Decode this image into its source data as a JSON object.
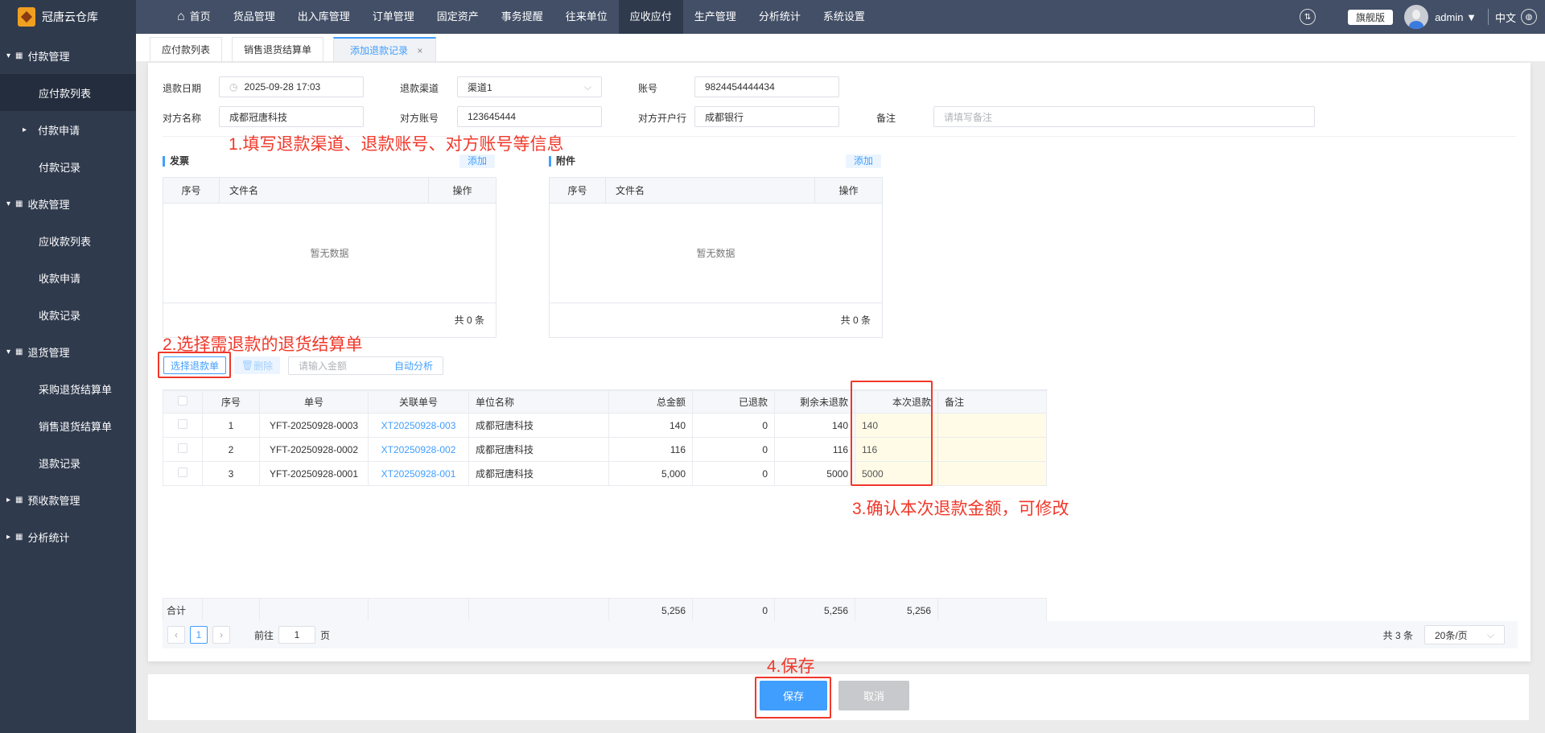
{
  "app": {
    "title": "冠唐云仓库"
  },
  "topnav": {
    "items": [
      "首页",
      "货品管理",
      "出入库管理",
      "订单管理",
      "固定资产",
      "事务提醒",
      "往来单位",
      "应收应付",
      "生产管理",
      "分析统计",
      "系统设置"
    ],
    "active": "应收应付",
    "edition": "旗舰版",
    "user": "admin",
    "language": "中文"
  },
  "sidebar": {
    "items": [
      {
        "label": "付款管理",
        "type": "group"
      },
      {
        "label": "应付款列表",
        "type": "sub",
        "active": true
      },
      {
        "label": "付款申请",
        "type": "sub-arrow"
      },
      {
        "label": "付款记录",
        "type": "sub"
      },
      {
        "label": "收款管理",
        "type": "group"
      },
      {
        "label": "应收款列表",
        "type": "sub"
      },
      {
        "label": "收款申请",
        "type": "sub"
      },
      {
        "label": "收款记录",
        "type": "sub"
      },
      {
        "label": "退货管理",
        "type": "group"
      },
      {
        "label": "采购退货结算单",
        "type": "sub"
      },
      {
        "label": "销售退货结算单",
        "type": "sub"
      },
      {
        "label": "退款记录",
        "type": "sub"
      },
      {
        "label": "预收款管理",
        "type": "group-collapsed"
      },
      {
        "label": "分析统计",
        "type": "group-collapsed"
      }
    ]
  },
  "tabs": [
    {
      "label": "应付款列表"
    },
    {
      "label": "销售退货结算单"
    },
    {
      "label": "添加退款记录",
      "active": true,
      "close": "×"
    }
  ],
  "form": {
    "refund_date_label": "退款日期",
    "refund_date": "2025-09-28 17:03",
    "channel_label": "退款渠道",
    "channel": "渠道1",
    "account_label": "账号",
    "account": "9824454444434",
    "party_name_label": "对方名称",
    "party_name": "成都冠唐科技",
    "party_account_label": "对方账号",
    "party_account": "123645444",
    "party_bank_label": "对方开户行",
    "party_bank": "成都银行",
    "remark_label": "备注",
    "remark_placeholder": "请填写备注"
  },
  "annotations": {
    "a1": "1.填写退款渠道、退款账号、对方账号等信息",
    "a2": "2.选择需退款的退货结算单",
    "a3": "3.确认本次退款金额，可修改",
    "a4": "4.保存"
  },
  "invoice": {
    "title": "发票",
    "add": "添加",
    "cols": [
      "序号",
      "文件名",
      "操作"
    ],
    "empty": "暂无数据",
    "footer": "共 0 条"
  },
  "attachment": {
    "title": "附件",
    "add": "添加",
    "cols": [
      "序号",
      "文件名",
      "操作"
    ],
    "empty": "暂无数据",
    "footer": "共 0 条"
  },
  "toolbar": {
    "select": "选择退款单",
    "delete": "删除",
    "amount_placeholder": "请输入金额",
    "auto": "自动分析"
  },
  "table": {
    "headers": [
      "序号",
      "单号",
      "关联单号",
      "单位名称",
      "总金额",
      "已退款",
      "剩余未退款",
      "本次退款",
      "备注"
    ],
    "rows": [
      {
        "no": "1",
        "code": "YFT-20250928-0003",
        "ref": "XT20250928-003",
        "unit": "成都冠唐科技",
        "total": "140",
        "refunded": "0",
        "remaining": "140",
        "this": "140",
        "remark": ""
      },
      {
        "no": "2",
        "code": "YFT-20250928-0002",
        "ref": "XT20250928-002",
        "unit": "成都冠唐科技",
        "total": "116",
        "refunded": "0",
        "remaining": "116",
        "this": "116",
        "remark": ""
      },
      {
        "no": "3",
        "code": "YFT-20250928-0001",
        "ref": "XT20250928-001",
        "unit": "成都冠唐科技",
        "total": "5,000",
        "refunded": "0",
        "remaining": "5000",
        "this": "5000",
        "remark": ""
      }
    ],
    "summary": {
      "label": "合计",
      "total": "5,256",
      "refunded": "0",
      "remaining": "5,256",
      "this": "5,256"
    }
  },
  "pagination": {
    "current": "1",
    "goto_label": "前往",
    "goto_value": "1",
    "page_suffix": "页",
    "total": "共 3 条",
    "page_size": "20条/页"
  },
  "footer": {
    "save": "保存",
    "cancel": "取消"
  }
}
